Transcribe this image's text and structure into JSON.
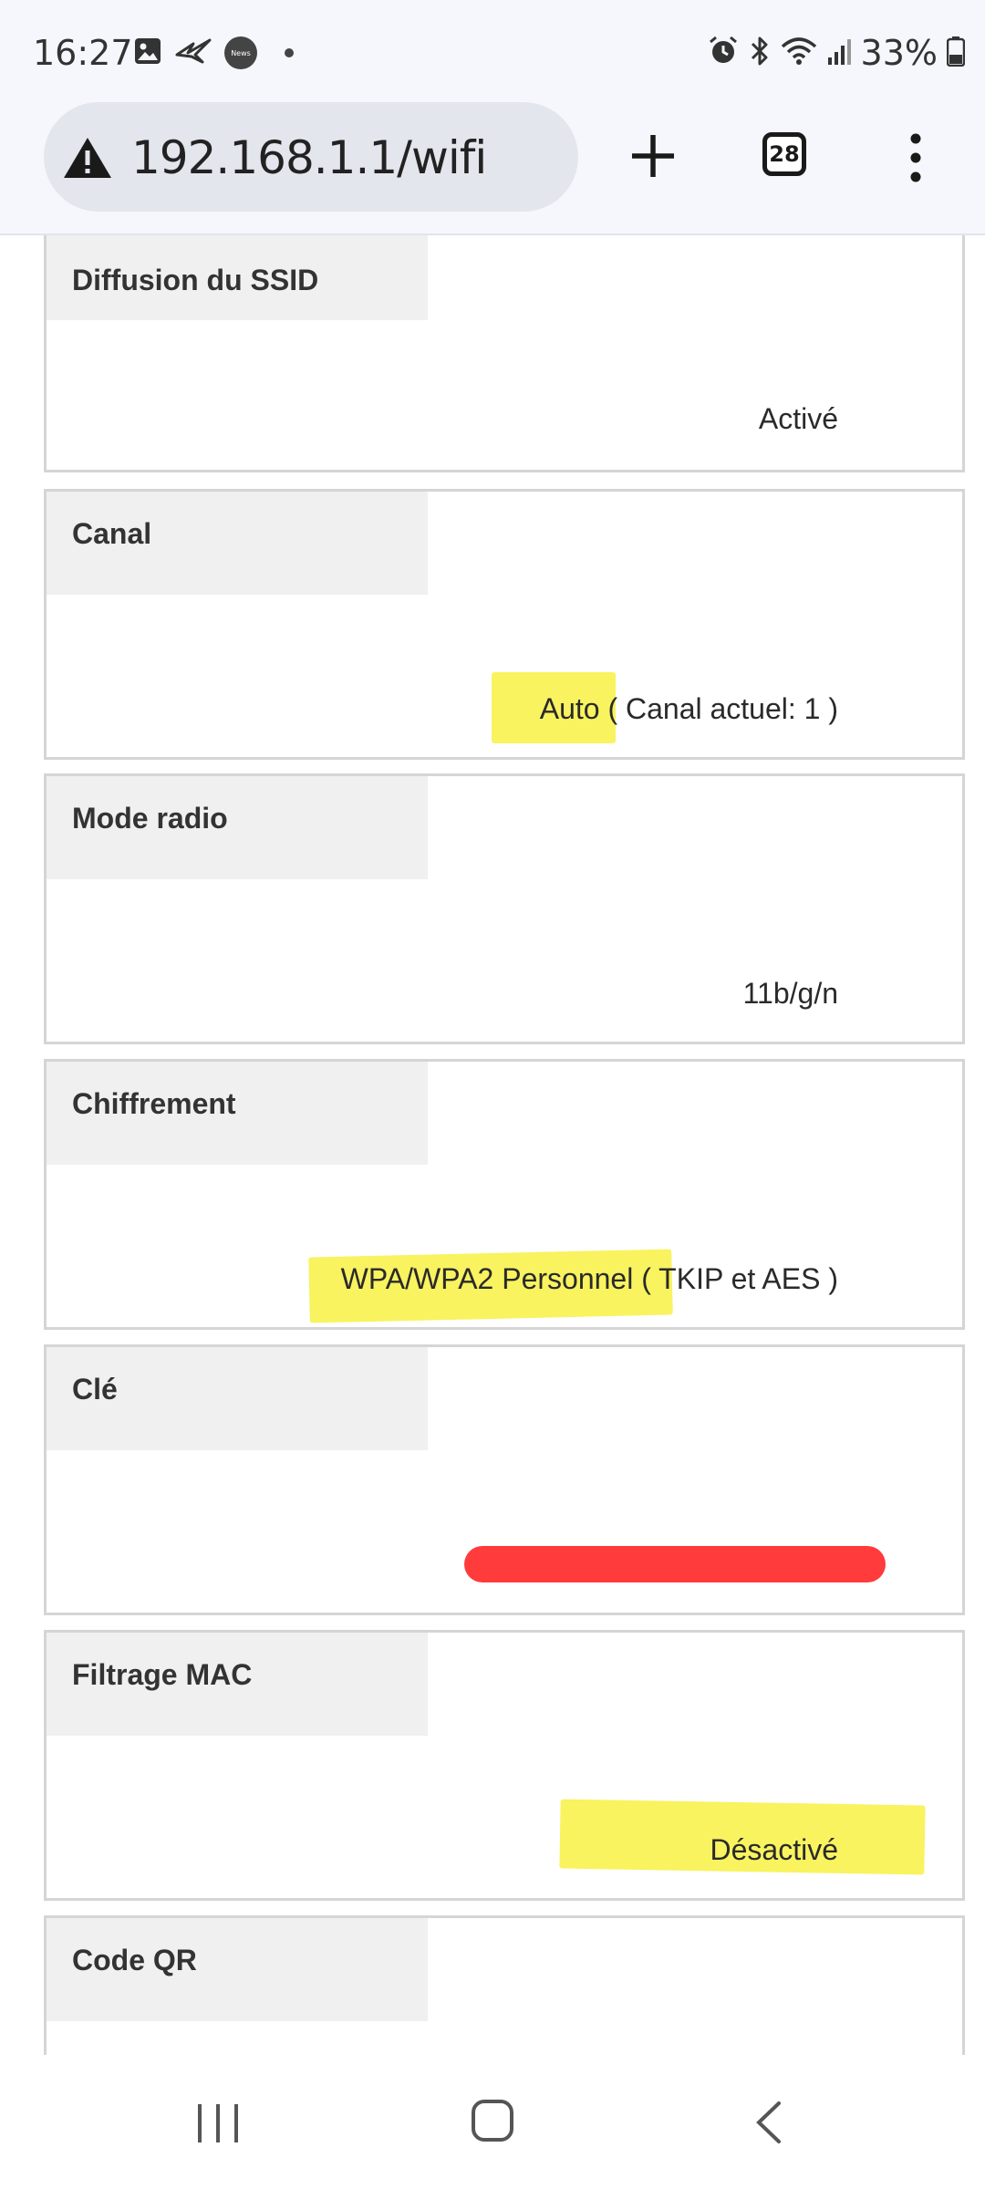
{
  "status_bar": {
    "time": "16:27",
    "news_badge": "News",
    "battery": "33%",
    "icons_left": [
      "image-icon",
      "fan-bird-icon",
      "news-icon",
      "notification-dot-icon"
    ],
    "icons_right": [
      "alarm-icon",
      "bluetooth-icon",
      "wifi-icon",
      "signal-icon",
      "battery-icon"
    ]
  },
  "browser": {
    "url": "192.168.1.1/wifi",
    "tab_count": "28",
    "security_icon": "warning-icon"
  },
  "settings": [
    {
      "label": "Diffusion du SSID",
      "value": "Activé"
    },
    {
      "label": "Canal",
      "value": "Auto ( Canal actuel: 1 )"
    },
    {
      "label": "Mode radio",
      "value": "11b/g/n"
    },
    {
      "label": "Chiffrement",
      "value": "WPA/WPA2 Personnel ( TKIP et AES )"
    },
    {
      "label": "Clé",
      "value": ""
    },
    {
      "label": "Filtrage MAC",
      "value": "Désactivé"
    },
    {
      "label": "Code QR",
      "value": ""
    }
  ],
  "colors": {
    "highlight": "#f6f03c",
    "redaction": "#ff3b3b",
    "label_bg": "#f0f0f0",
    "border": "#d5d5d5"
  },
  "nav_bar": {
    "icons": [
      "recent-apps-icon",
      "home-icon",
      "back-icon"
    ]
  }
}
